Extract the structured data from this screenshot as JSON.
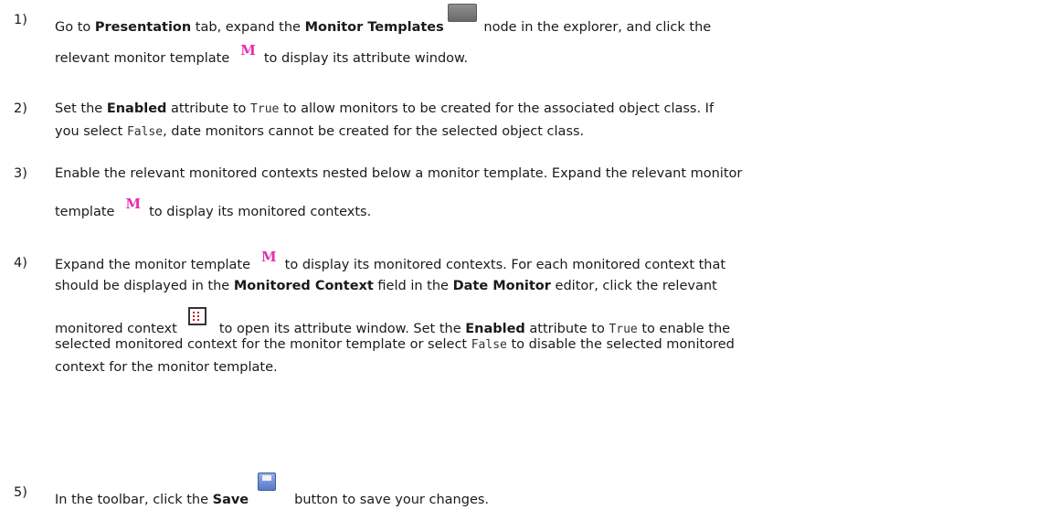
{
  "steps": [
    {
      "num": "1)",
      "l1": {
        "a": "Go to ",
        "b": "Presentation",
        "c": " tab, expand the ",
        "d": "Monitor Templates",
        "e": " node in the explorer, and click the"
      },
      "l2": {
        "a": "relevant monitor template",
        "b": "to display its attribute window."
      }
    },
    {
      "num": "2)",
      "l1": {
        "a": "Set the ",
        "b": "Enabled",
        "c": " attribute to ",
        "code": "True",
        "d": " to allow monitors to be created for the associated object class. If"
      },
      "l2": {
        "a": "you select ",
        "code": "False",
        "b": ", date monitors cannot be created for the selected object class."
      }
    },
    {
      "num": "3)",
      "l1": {
        "a": "Enable the relevant monitored contexts nested below a monitor template. Expand the relevant monitor"
      },
      "l2": {
        "a": "template",
        "b": "to display its monitored contexts."
      }
    },
    {
      "num": "4)",
      "l1": {
        "a": "Expand the monitor template",
        "b": "to display its monitored contexts. For each monitored context that"
      },
      "l2": {
        "a": "should be displayed in the ",
        "b": "Monitored Context",
        "c": " field in the ",
        "d": "Date Monitor",
        "e": " editor, click the relevant"
      },
      "l3": {
        "a": "monitored context",
        "b": "to open its attribute window. Set the ",
        "c": "Enabled",
        "d": " attribute to ",
        "code": "True",
        "e": " to enable the"
      },
      "l4": {
        "a": "selected monitored context for the monitor template or select ",
        "code": "False",
        "b": " to disable the selected monitored"
      },
      "l5": {
        "a": "context for the monitor template."
      }
    },
    {
      "num": "5)",
      "l1": {
        "a": "In the toolbar, click the ",
        "b": "Save",
        "c": "button to save your changes."
      }
    }
  ],
  "icons": {
    "folder": "folder-icon",
    "monitor_template": "monitor-template-icon",
    "monitored_context": "monitored-context-icon",
    "save": "save-icon"
  }
}
